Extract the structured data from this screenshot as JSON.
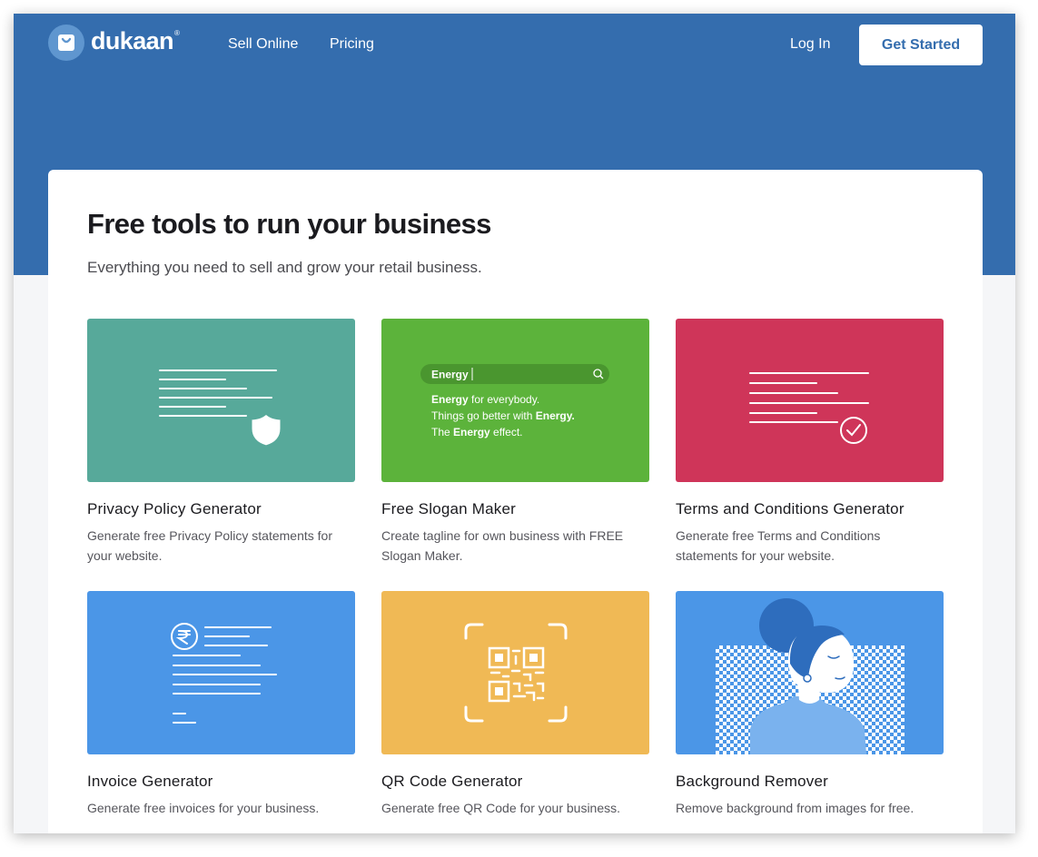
{
  "header": {
    "logo_text": "dukaan",
    "logo_reg": "®",
    "nav": [
      "Sell Online",
      "Pricing"
    ],
    "login": "Log In",
    "cta": "Get Started"
  },
  "main": {
    "title": "Free tools to run your business",
    "subtitle": "Everything you need to sell and grow your retail business."
  },
  "slogan_preview": {
    "search_text": "Energy",
    "line1_bold": "Energy",
    "line1_rest": " for everybody.",
    "line2_pre": "Things go better with ",
    "line2_bold": "Energy.",
    "line3_pre": "The ",
    "line3_bold": "Energy",
    "line3_rest": " effect."
  },
  "tools": [
    {
      "name": "Privacy Policy Generator",
      "desc": "Generate free Privacy Policy statements for your website.",
      "color": "#57a99a",
      "icon": "document-shield-icon"
    },
    {
      "name": "Free Slogan Maker",
      "desc": "Create tagline for own business with FREE Slogan Maker.",
      "color": "#5cb33b",
      "icon": "slogan-preview"
    },
    {
      "name": "Terms and Conditions Generator",
      "desc": "Generate free Terms and Conditions statements for your website.",
      "color": "#cf3559",
      "icon": "document-check-icon"
    },
    {
      "name": "Invoice Generator",
      "desc": "Generate free invoices for your business.",
      "color": "#4b96e7",
      "icon": "rupee-invoice-icon"
    },
    {
      "name": "QR Code Generator",
      "desc": "Generate free QR Code for your business.",
      "color": "#f0b955",
      "icon": "qr-code-icon"
    },
    {
      "name": "Background Remover",
      "desc": "Remove background from images for free.",
      "color": "#4b96e7",
      "icon": "person-cutout-icon"
    }
  ]
}
